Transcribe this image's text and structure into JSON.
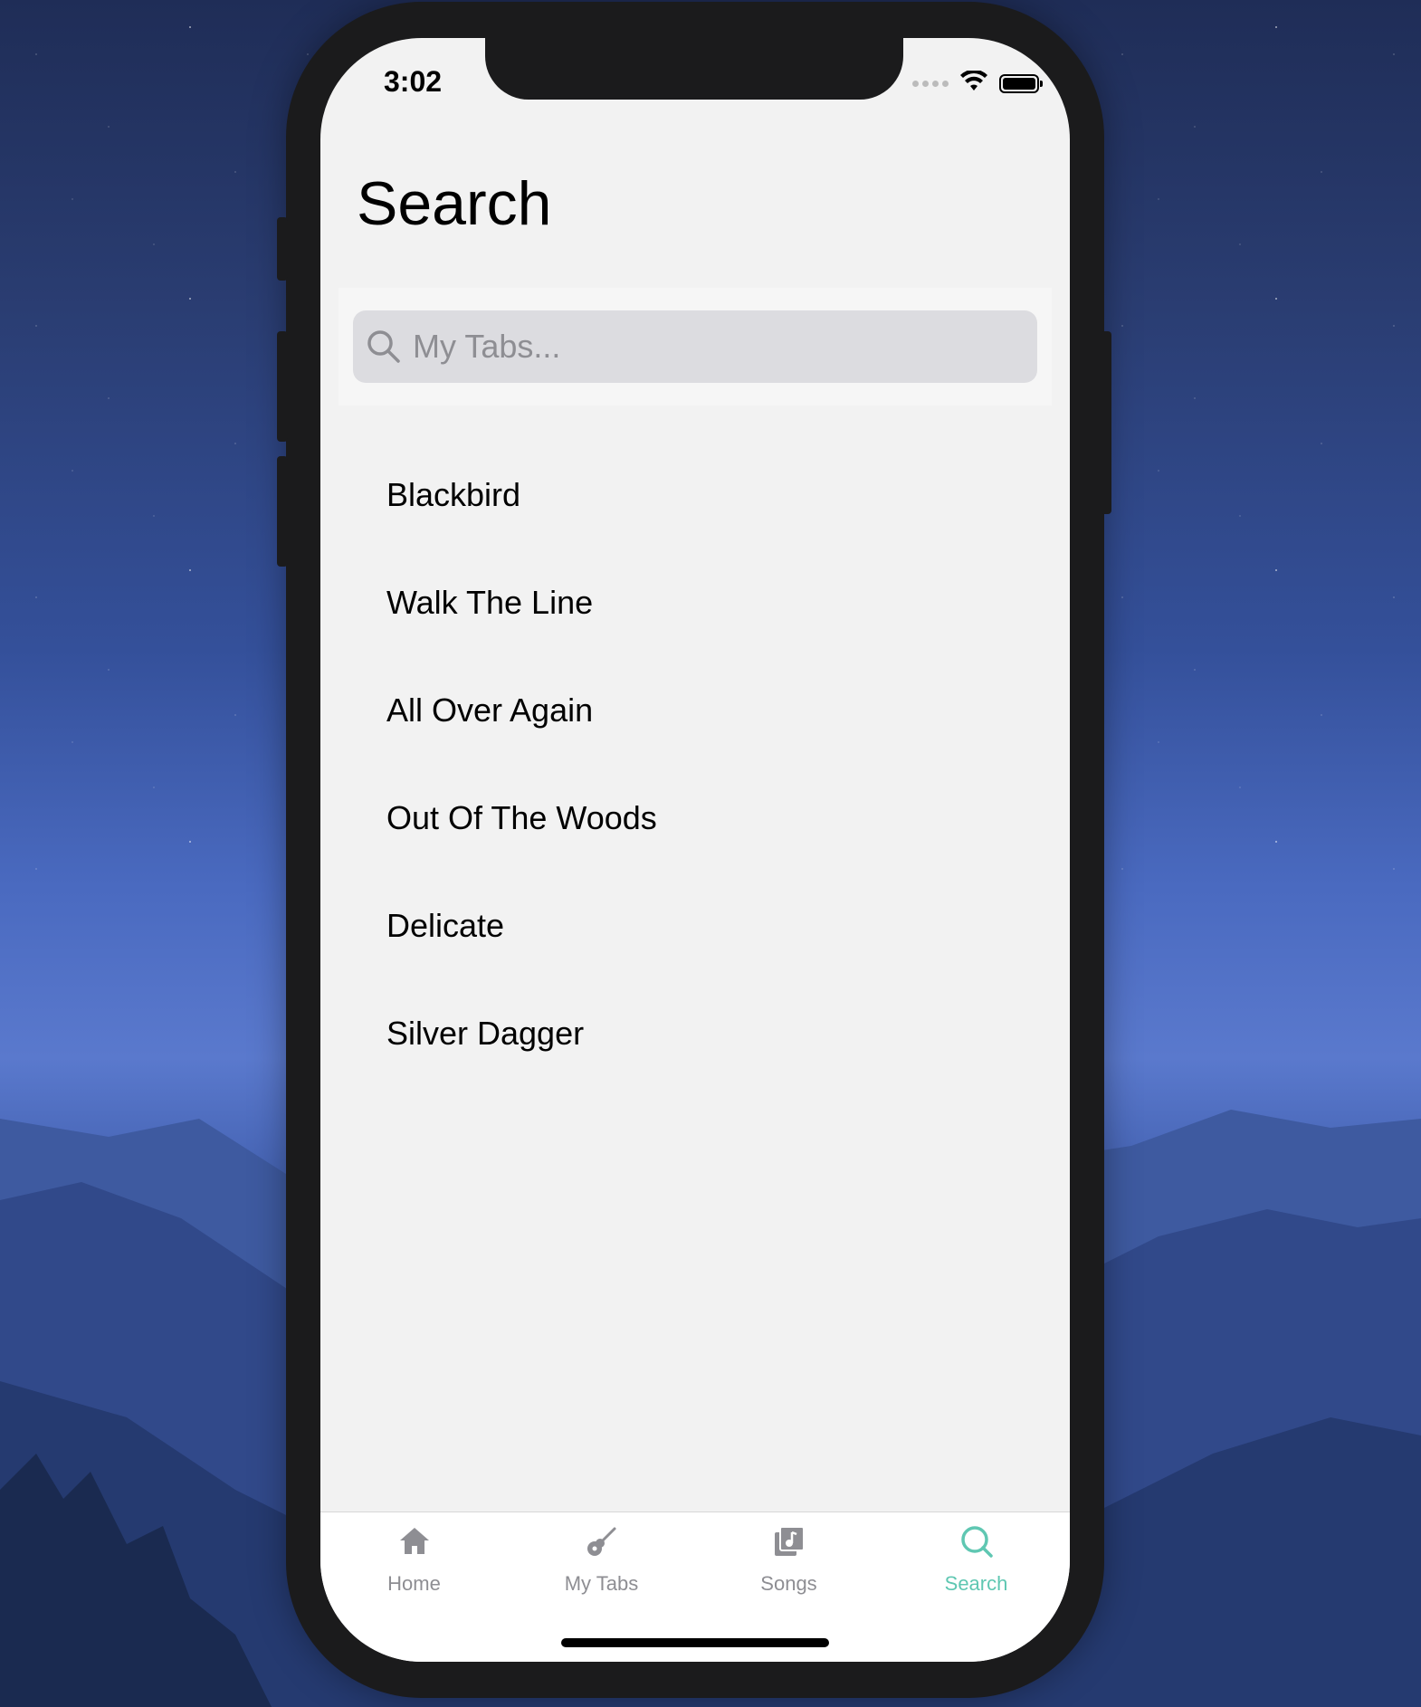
{
  "status_bar": {
    "time": "3:02"
  },
  "page": {
    "title": "Search"
  },
  "search": {
    "placeholder": "My Tabs..."
  },
  "results": [
    {
      "label": "Blackbird"
    },
    {
      "label": "Walk The Line"
    },
    {
      "label": "All Over Again"
    },
    {
      "label": "Out Of The Woods"
    },
    {
      "label": "Delicate"
    },
    {
      "label": "Silver Dagger"
    }
  ],
  "tab_bar": {
    "tabs": [
      {
        "label": "Home",
        "icon": "home-icon"
      },
      {
        "label": "My Tabs",
        "icon": "guitar-icon"
      },
      {
        "label": "Songs",
        "icon": "music-library-icon"
      },
      {
        "label": "Search",
        "icon": "search-icon",
        "active": true
      }
    ]
  },
  "colors": {
    "accent": "#5fc7b2",
    "inactive": "#8e8e93",
    "screen_background": "#f2f2f2",
    "search_field": "#dcdce0"
  }
}
